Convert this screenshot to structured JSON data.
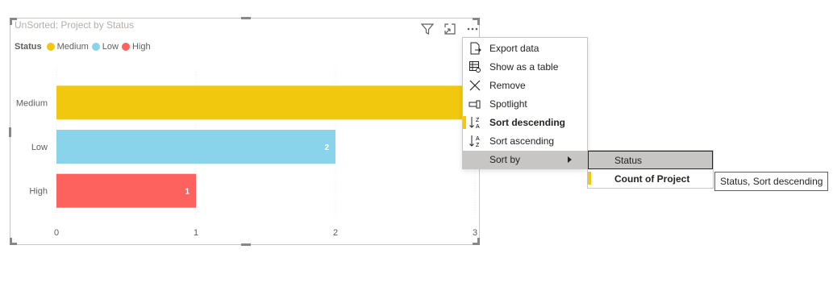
{
  "visual": {
    "title": "UnSorted: Project by Status",
    "legend": {
      "title": "Status",
      "items": [
        {
          "label": "Medium",
          "color": "#f2c80f"
        },
        {
          "label": "Low",
          "color": "#8ad4eb"
        },
        {
          "label": "High",
          "color": "#fd625e"
        }
      ]
    },
    "header_icons": [
      "filter-icon",
      "focus-mode-icon",
      "more-options-icon"
    ]
  },
  "chart_data": {
    "type": "bar",
    "orientation": "horizontal",
    "categories": [
      "Medium",
      "Low",
      "High"
    ],
    "values": [
      3,
      2,
      1
    ],
    "colors": [
      "#f2c80f",
      "#8ad4eb",
      "#fd625e"
    ],
    "data_labels": [
      "",
      "2",
      "1"
    ],
    "x_ticks": [
      "0",
      "1",
      "2",
      "3"
    ],
    "xlim": [
      0,
      3
    ],
    "grid": true
  },
  "context_menu": {
    "items": [
      {
        "label": "Export data",
        "icon": "export-data-icon"
      },
      {
        "label": "Show as a table",
        "icon": "show-table-icon"
      },
      {
        "label": "Remove",
        "icon": "remove-icon"
      },
      {
        "label": "Spotlight",
        "icon": "spotlight-icon"
      },
      {
        "label": "Sort descending",
        "icon": "sort-descending-icon"
      },
      {
        "label": "Sort ascending",
        "icon": "sort-ascending-icon"
      },
      {
        "label": "Sort by",
        "icon": ""
      }
    ]
  },
  "sort_by_submenu": {
    "items": [
      {
        "label": "Status"
      },
      {
        "label": "Count of Project"
      }
    ]
  },
  "tooltip": {
    "text": "Status, Sort descending"
  },
  "colors": {
    "accent": "#f2c811",
    "menu_hover": "#c8c6c4"
  }
}
